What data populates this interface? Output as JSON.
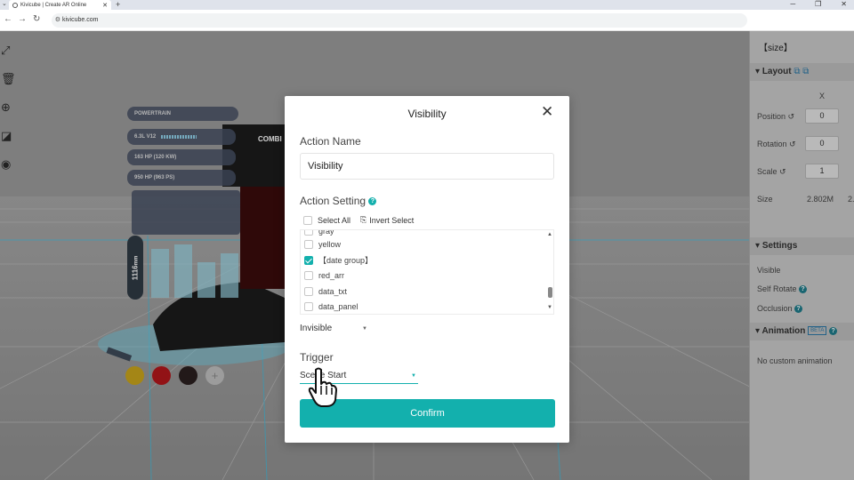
{
  "browser": {
    "tab_title": "Kivicube | Create AR Online",
    "new_tab": "+",
    "url": "kivicube.com"
  },
  "left_tools": [
    "fullscreen-icon",
    "trash-icon",
    "target-icon",
    "resize-icon",
    "eye-icon"
  ],
  "right_panel": {
    "title": "【size】",
    "layout_label": "Layout",
    "x_header": "X",
    "position_label": "Position",
    "position_x": "0",
    "rotation_label": "Rotation",
    "rotation_x": "0",
    "scale_label": "Scale",
    "scale_x": "1",
    "size_label": "Size",
    "size_x": "2.802M",
    "size_y": "2.",
    "settings_label": "Settings",
    "visible_label": "Visible",
    "self_rotate_label": "Self Rotate",
    "occlusion_label": "Occlusion",
    "animation_label": "Animation",
    "beta": "BETA",
    "no_animation": "No custom animation"
  },
  "scene": {
    "powertrain": "POWERTRAIN",
    "engine": "6.3L V12",
    "power1": "163 HP (120 KW)",
    "power2": "950 HP (963 PS)",
    "combi": "COMBI",
    "gauge": "1116",
    "gauge_unit": "mm",
    "color_swatches": [
      "#c9a41b",
      "#b3161b",
      "#2a1f1f",
      "#bfbfbf"
    ]
  },
  "modal": {
    "title": "Visibility",
    "action_name_label": "Action Name",
    "action_name_value": "Visibility",
    "action_setting_label": "Action Setting",
    "help": "?",
    "select_all": "Select All",
    "invert_select": "Invert Select",
    "items": [
      {
        "label": "gray",
        "checked": false
      },
      {
        "label": "yellow",
        "checked": false
      },
      {
        "label": "【date group】",
        "checked": true
      },
      {
        "label": "red_arr",
        "checked": false
      },
      {
        "label": "data_txt",
        "checked": false
      },
      {
        "label": "data_panel",
        "checked": false
      }
    ],
    "visibility_value": "Invisible",
    "trigger_label": "Trigger",
    "trigger_value": "Scene Start",
    "confirm": "Confirm"
  },
  "colors": {
    "accent": "#13b0ad",
    "panel_bg": "#c9c9c9"
  }
}
